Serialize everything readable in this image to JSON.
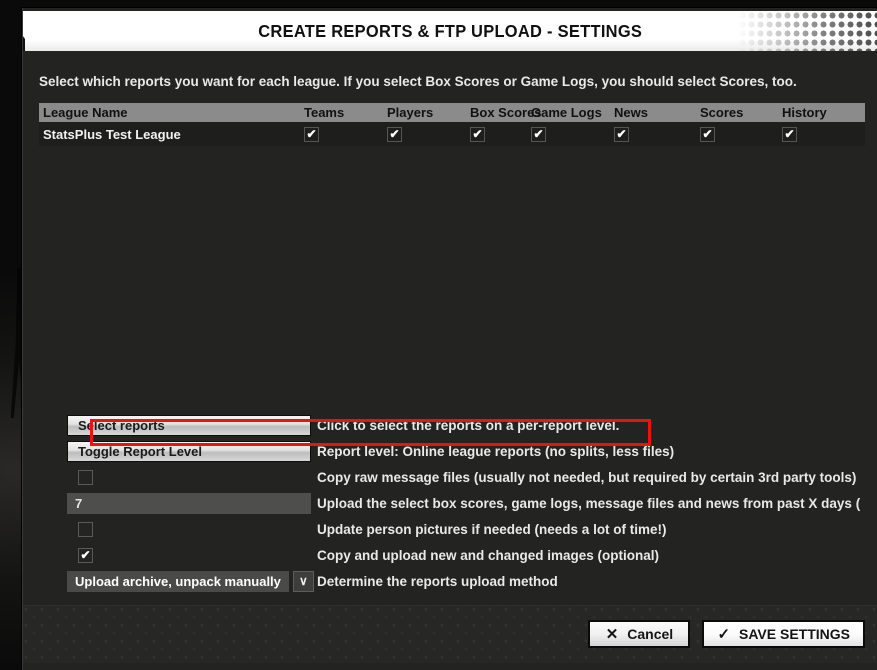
{
  "dialog": {
    "title": "CREATE REPORTS & FTP UPLOAD - SETTINGS",
    "instruction": "Select which reports you want for each league. If you select Box Scores or Game Logs, you should select Scores, too."
  },
  "table": {
    "columns": [
      "League Name",
      "Teams",
      "Players",
      "Box Scores",
      "Game Logs",
      "News",
      "Scores",
      "History"
    ],
    "rows": [
      {
        "league_name": "StatsPlus Test League",
        "teams": true,
        "players": true,
        "box_scores": true,
        "game_logs": true,
        "news": true,
        "scores": true,
        "history": true,
        "check_glyph": "✔"
      }
    ]
  },
  "options": [
    {
      "control": "button",
      "label": "Select reports",
      "description": "Click to select the reports on a per-report level.",
      "highlighted": true
    },
    {
      "control": "button",
      "label": "Toggle Report Level",
      "description": "Report level: Online league reports (no splits, less files)",
      "highlighted": false
    },
    {
      "control": "checkbox",
      "checked": false,
      "check_glyph": "✔",
      "description": "Copy raw message files (usually not needed, but required by certain 3rd party tools)"
    },
    {
      "control": "input",
      "value": "7",
      "description": "Upload the select box scores, game logs, message files and news from past X days ("
    },
    {
      "control": "checkbox",
      "checked": false,
      "check_glyph": "✔",
      "description": "Update person pictures if needed (needs a lot of time!)"
    },
    {
      "control": "checkbox",
      "checked": true,
      "check_glyph": "✔",
      "description": "Copy and upload new and changed images (optional)"
    },
    {
      "control": "dropdown",
      "value": "Upload archive, unpack manually",
      "arrow_glyph": "∨",
      "description": "Determine the reports upload method"
    }
  ],
  "footer": {
    "cancel_label": "Cancel",
    "cancel_glyph": "✕",
    "save_label": "SAVE SETTINGS",
    "save_glyph": "✓"
  },
  "colors": {
    "highlight": "#ee1111",
    "table_header_bg": "#8b8b8b",
    "dialog_bg": "#232322"
  }
}
